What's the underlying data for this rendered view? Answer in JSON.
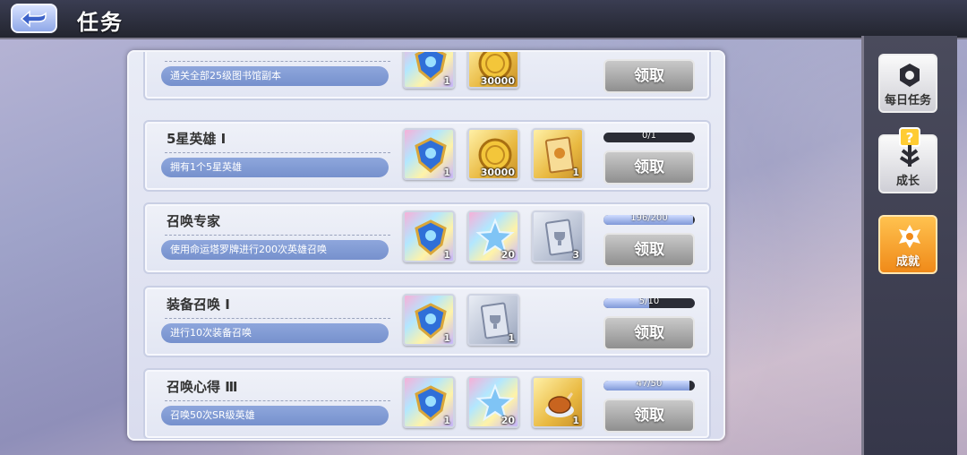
{
  "header": {
    "title": "任务",
    "back_icon": "back-arrow-icon"
  },
  "sidebar": {
    "items": [
      {
        "label": "每日任务",
        "icon": "daily-task-icon",
        "active": false
      },
      {
        "label": "成长",
        "icon": "growth-icon",
        "active": false,
        "badge": "?"
      },
      {
        "label": "成就",
        "icon": "achievement-icon",
        "active": true
      }
    ]
  },
  "tasks": [
    {
      "name": "",
      "desc": "通关全部25级图书馆副本",
      "rewards": [
        {
          "icon": "gem-emblem-icon",
          "qty": "1"
        },
        {
          "icon": "gold-coin-icon",
          "qty": "30000"
        }
      ],
      "progress": null,
      "button": "领取"
    },
    {
      "name": "5星英雄 Ⅰ",
      "desc": "拥有1个5星英雄",
      "rewards": [
        {
          "icon": "gem-emblem-icon",
          "qty": "1"
        },
        {
          "icon": "gold-coin-icon",
          "qty": "30000"
        },
        {
          "icon": "hero-card-icon",
          "qty": "1"
        }
      ],
      "progress": {
        "text": "0/1",
        "value": 0
      },
      "button": "领取"
    },
    {
      "name": "召唤专家",
      "desc": "使用命运塔罗牌进行200次英雄召唤",
      "rewards": [
        {
          "icon": "gem-emblem-icon",
          "qty": "1"
        },
        {
          "icon": "star-crystal-icon",
          "qty": "20"
        },
        {
          "icon": "summon-card-icon",
          "qty": "3"
        }
      ],
      "progress": {
        "text": "196/200",
        "value": 0.98
      },
      "button": "领取"
    },
    {
      "name": "装备召唤 Ⅰ",
      "desc": "进行10次装备召唤",
      "rewards": [
        {
          "icon": "gem-emblem-icon",
          "qty": "1"
        },
        {
          "icon": "summon-card-icon",
          "qty": "1"
        }
      ],
      "progress": {
        "text": "5/10",
        "value": 0.5
      },
      "button": "领取"
    },
    {
      "name": "召唤心得 Ⅲ",
      "desc": "召唤50次SR级英雄",
      "rewards": [
        {
          "icon": "gem-emblem-icon",
          "qty": "1"
        },
        {
          "icon": "star-crystal-icon",
          "qty": "20"
        },
        {
          "icon": "roast-chicken-icon",
          "qty": "1"
        }
      ],
      "progress": {
        "text": "47/50",
        "value": 0.94
      },
      "button": "领取"
    }
  ]
}
